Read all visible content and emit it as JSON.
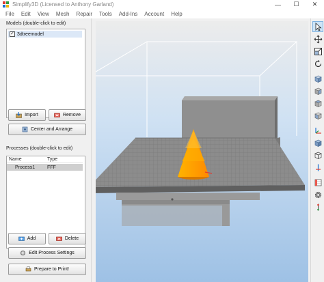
{
  "window": {
    "title": "Simplify3D (Licensed to Anthony Garland)",
    "minimize": "—",
    "maximize": "☐",
    "close": "✕"
  },
  "menu": [
    "File",
    "Edit",
    "View",
    "Mesh",
    "Repair",
    "Tools",
    "Add-Ins",
    "Account",
    "Help"
  ],
  "models": {
    "title": "Models (double-click to edit)",
    "items": [
      {
        "name": "3dtreemodel",
        "checked": true
      }
    ],
    "import_label": "Import",
    "remove_label": "Remove",
    "center_label": "Center and Arrange"
  },
  "processes": {
    "title": "Processes (double-click to edit)",
    "columns": [
      "Name",
      "Type"
    ],
    "rows": [
      {
        "name": "Process1",
        "type": "FFF"
      }
    ],
    "add_label": "Add",
    "delete_label": "Delete",
    "edit_label": "Edit Process Settings",
    "print_label": "Prepare to Print!"
  },
  "colors": {
    "accent": "#3a82d6",
    "model": "#ffa200",
    "bed": "#8a8a8a",
    "viewport_top": "#ececec",
    "viewport_bottom": "#9ec1e5"
  },
  "toolbar_icons": [
    "select-arrow-icon",
    "move-icon",
    "scale-icon",
    "rotate-icon",
    "view-default-icon",
    "view-front-icon",
    "view-top-icon",
    "view-side-icon",
    "axis-triad-icon",
    "cube-solid-icon",
    "cube-wireframe-icon",
    "cross-section-icon",
    "build-table-icon",
    "settings-gear-icon",
    "ruler-icon"
  ]
}
